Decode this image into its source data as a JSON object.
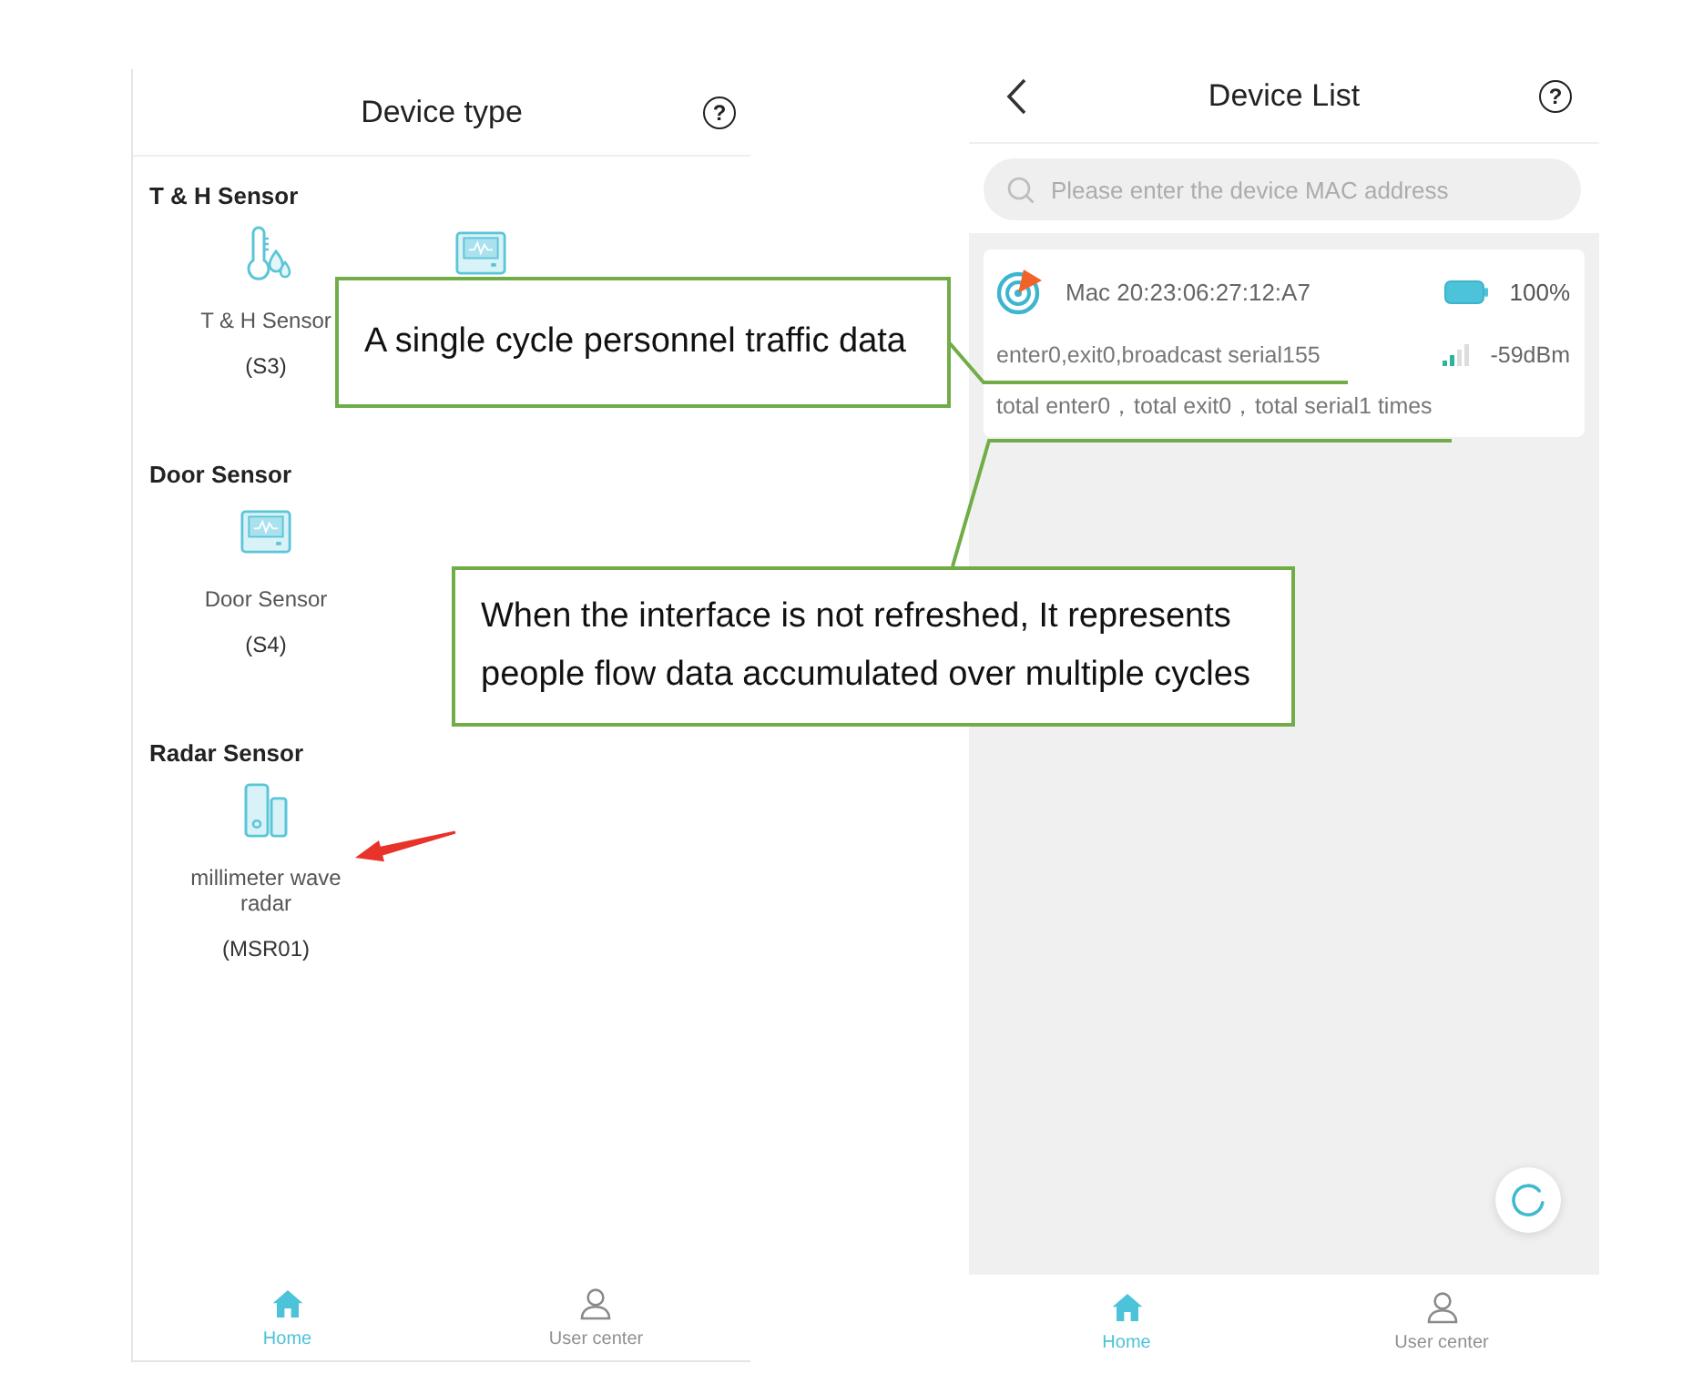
{
  "device_type_screen": {
    "title": "Device type",
    "help": "?",
    "sections": [
      {
        "heading": "T & H Sensor",
        "items": [
          {
            "kind": "thermo",
            "name": "T & H Sensor",
            "model": "(S3)"
          },
          {
            "kind": "panel"
          }
        ]
      },
      {
        "heading": "Door Sensor",
        "items": [
          {
            "kind": "panel",
            "name": "Door Sensor",
            "model": "(S4)"
          }
        ]
      },
      {
        "heading": "Radar Sensor",
        "items": [
          {
            "kind": "radar",
            "name": "millimeter wave radar",
            "model": "(MSR01)"
          }
        ]
      }
    ],
    "tabs": [
      {
        "kind": "home",
        "label": "Home",
        "selected": true
      },
      {
        "kind": "user",
        "label": "User center",
        "selected": false
      }
    ]
  },
  "device_list_screen": {
    "title": "Device List",
    "help": "?",
    "search": {
      "placeholder": "Please enter the device MAC address"
    },
    "devices": [
      {
        "mac": "Mac 20:23:06:27:12:A7",
        "battery": "100%",
        "counts": "enter0,exit0,broadcast serial155",
        "signal": "-59dBm",
        "totals": "total enter0，total exit0，total serial1 times"
      }
    ],
    "tabs": [
      {
        "kind": "home",
        "label": "Home",
        "selected": true
      },
      {
        "kind": "user",
        "label": "User center",
        "selected": false
      }
    ]
  },
  "annotations": [
    {
      "kind": "callout",
      "lines": [
        "A single cycle personnel traffic data"
      ]
    },
    {
      "kind": "callout",
      "lines": [
        "When the interface is not refreshed, It represents",
        "people flow data accumulated over multiple cycles"
      ]
    },
    {
      "kind": "arrow"
    }
  ]
}
